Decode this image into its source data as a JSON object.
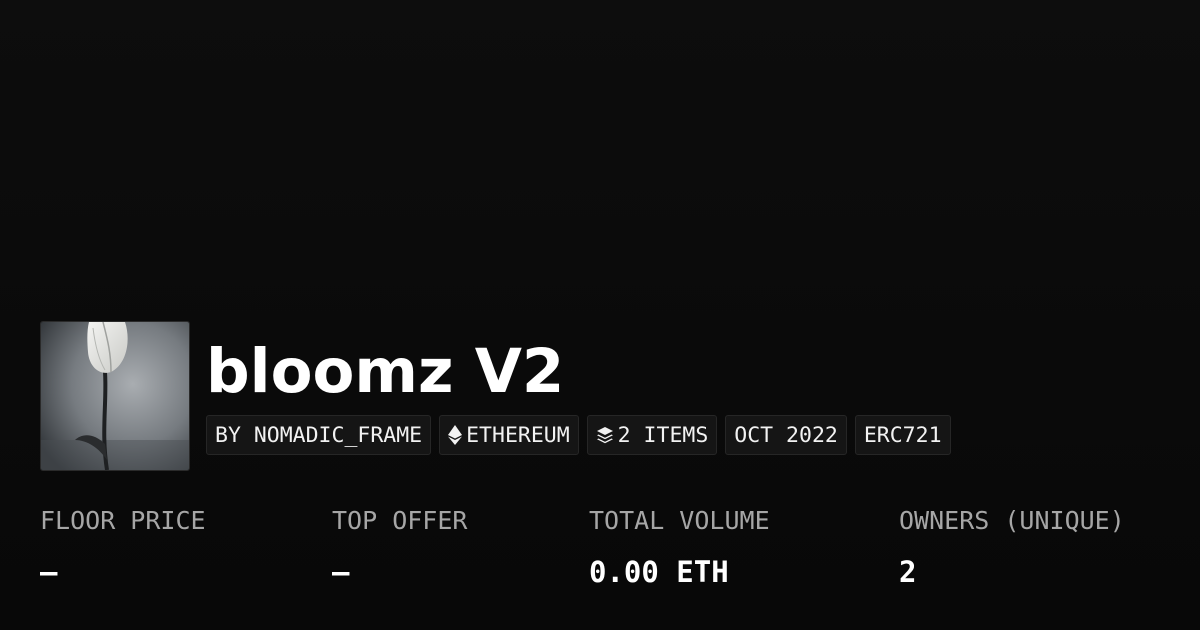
{
  "collection": {
    "title": "bloomz V2",
    "thumbnail_icon": "tulip-photo"
  },
  "chips": {
    "creator": "BY NOMADIC_FRAME",
    "chain": "ETHEREUM",
    "chain_icon": "ethereum-icon",
    "items": "2 ITEMS",
    "items_icon": "layers-icon",
    "date": "OCT 2022",
    "standard": "ERC721"
  },
  "stats": {
    "floor_price": {
      "label": "FLOOR PRICE",
      "value": "–"
    },
    "top_offer": {
      "label": "TOP OFFER",
      "value": "–"
    },
    "total_volume": {
      "label": "TOTAL VOLUME",
      "value": "0.00 ETH"
    },
    "owners": {
      "label": "OWNERS (UNIQUE)",
      "value": "2"
    }
  },
  "colors": {
    "background": "#0b0b0b",
    "text": "#ffffff",
    "muted": "#a6a6a6",
    "chip_bg": "#151515"
  }
}
